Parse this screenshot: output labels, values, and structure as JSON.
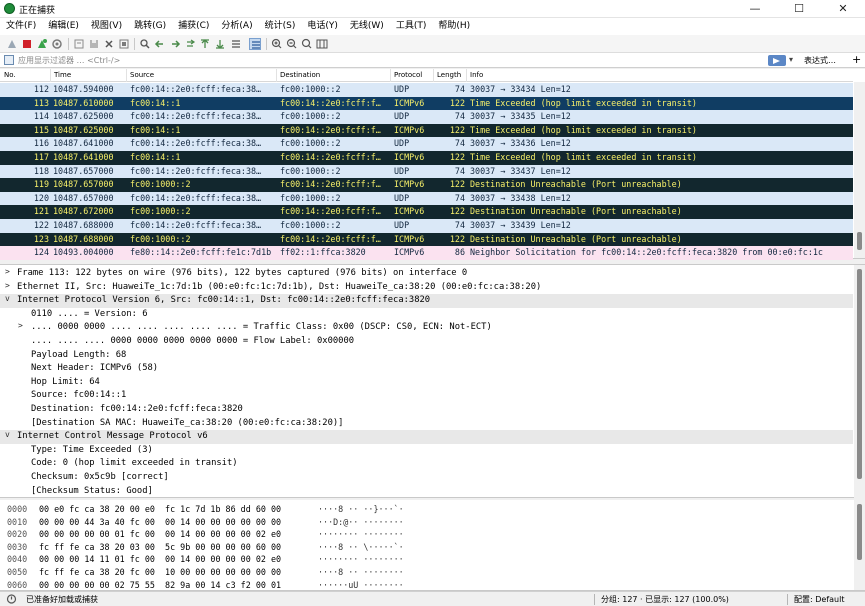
{
  "window": {
    "title": "正在捕获",
    "minimize": "—",
    "maximize": "☐",
    "close": "✕"
  },
  "menu": [
    "文件(F)",
    "编辑(E)",
    "视图(V)",
    "跳转(G)",
    "捕获(C)",
    "分析(A)",
    "统计(S)",
    "电话(Y)",
    "无线(W)",
    "工具(T)",
    "帮助(H)"
  ],
  "toolbar_icons": [
    "start-capture-icon",
    "stop-capture-icon",
    "restart-capture-icon",
    "capture-options-icon",
    "open-file-icon",
    "save-file-icon",
    "close-file-icon",
    "reload-file-icon",
    "find-packet-icon",
    "go-back-icon",
    "go-forward-icon",
    "go-to-packet-icon",
    "go-first-icon",
    "go-last-icon",
    "auto-scroll-icon",
    "colorize-icon",
    "zoom-in-icon",
    "zoom-out-icon",
    "zoom-normal-icon",
    "resize-columns-icon"
  ],
  "filter": {
    "placeholder": "应用显示过滤器 … <Ctrl-/>",
    "dropdown": "▾",
    "expression_label": "表达式…",
    "add_label": "+"
  },
  "columns": [
    "No.",
    "Time",
    "Source",
    "Destination",
    "Protocol",
    "Length",
    "Info"
  ],
  "packets": [
    {
      "no": "112",
      "time": "10487.594000",
      "src": "fc00:14::2e0:fcff:feca:38…",
      "dst": "fc00:1000::2",
      "proto": "UDP",
      "len": "74",
      "info": "30037 → 33434 Len=12",
      "style": "light"
    },
    {
      "no": "113",
      "time": "10487.610000",
      "src": "fc00:14::1",
      "dst": "fc00:14::2e0:fcff:f…",
      "proto": "ICMPv6",
      "len": "122",
      "info": "Time Exceeded (hop limit exceeded in transit)",
      "style": "selected"
    },
    {
      "no": "114",
      "time": "10487.625000",
      "src": "fc00:14::2e0:fcff:feca:38…",
      "dst": "fc00:1000::2",
      "proto": "UDP",
      "len": "74",
      "info": "30037 → 33435 Len=12",
      "style": "light"
    },
    {
      "no": "115",
      "time": "10487.625000",
      "src": "fc00:14::1",
      "dst": "fc00:14::2e0:fcff:f…",
      "proto": "ICMPv6",
      "len": "122",
      "info": "Time Exceeded (hop limit exceeded in transit)",
      "style": "dark"
    },
    {
      "no": "116",
      "time": "10487.641000",
      "src": "fc00:14::2e0:fcff:feca:38…",
      "dst": "fc00:1000::2",
      "proto": "UDP",
      "len": "74",
      "info": "30037 → 33436 Len=12",
      "style": "light"
    },
    {
      "no": "117",
      "time": "10487.641000",
      "src": "fc00:14::1",
      "dst": "fc00:14::2e0:fcff:f…",
      "proto": "ICMPv6",
      "len": "122",
      "info": "Time Exceeded (hop limit exceeded in transit)",
      "style": "dark"
    },
    {
      "no": "118",
      "time": "10487.657000",
      "src": "fc00:14::2e0:fcff:feca:38…",
      "dst": "fc00:1000::2",
      "proto": "UDP",
      "len": "74",
      "info": "30037 → 33437 Len=12",
      "style": "light"
    },
    {
      "no": "119",
      "time": "10487.657000",
      "src": "fc00:1000::2",
      "dst": "fc00:14::2e0:fcff:f…",
      "proto": "ICMPv6",
      "len": "122",
      "info": "Destination Unreachable (Port unreachable)",
      "style": "dark"
    },
    {
      "no": "120",
      "time": "10487.657000",
      "src": "fc00:14::2e0:fcff:feca:38…",
      "dst": "fc00:1000::2",
      "proto": "UDP",
      "len": "74",
      "info": "30037 → 33438 Len=12",
      "style": "light"
    },
    {
      "no": "121",
      "time": "10487.672000",
      "src": "fc00:1000::2",
      "dst": "fc00:14::2e0:fcff:f…",
      "proto": "ICMPv6",
      "len": "122",
      "info": "Destination Unreachable (Port unreachable)",
      "style": "dark"
    },
    {
      "no": "122",
      "time": "10487.688000",
      "src": "fc00:14::2e0:fcff:feca:38…",
      "dst": "fc00:1000::2",
      "proto": "UDP",
      "len": "74",
      "info": "30037 → 33439 Len=12",
      "style": "light"
    },
    {
      "no": "123",
      "time": "10487.688000",
      "src": "fc00:1000::2",
      "dst": "fc00:14::2e0:fcff:f…",
      "proto": "ICMPv6",
      "len": "122",
      "info": "Destination Unreachable (Port unreachable)",
      "style": "dark"
    },
    {
      "no": "124",
      "time": "10493.004000",
      "src": "fe80::14::2e0:fcff:fe1c:7d1b",
      "dst": "ff02::1:ffca:3820",
      "proto": "ICMPv6",
      "len": "86",
      "info": "Neighbor Solicitation for fc00:14::2e0:fcff:feca:3820 from 00:e0:fc:1c",
      "style": "pink"
    }
  ],
  "details": [
    {
      "arrow": ">",
      "text": "Frame 113: 122 bytes on wire (976 bits), 122 bytes captured (976 bits) on interface 0",
      "level": 0,
      "header": false
    },
    {
      "arrow": ">",
      "text": "Ethernet II, Src: HuaweiTe_1c:7d:1b (00:e0:fc:1c:7d:1b), Dst: HuaweiTe_ca:38:20 (00:e0:fc:ca:38:20)",
      "level": 0,
      "header": false
    },
    {
      "arrow": "v",
      "text": "Internet Protocol Version 6, Src: fc00:14::1, Dst: fc00:14::2e0:fcff:feca:3820",
      "level": 0,
      "header": true
    },
    {
      "arrow": "",
      "text": "0110 .... = Version: 6",
      "level": 1,
      "header": false
    },
    {
      "arrow": ">",
      "text": ".... 0000 0000 .... .... .... .... .... = Traffic Class: 0x00 (DSCP: CS0, ECN: Not-ECT)",
      "level": 1,
      "header": false
    },
    {
      "arrow": "",
      "text": ".... .... .... 0000 0000 0000 0000 0000 = Flow Label: 0x00000",
      "level": 1,
      "header": false
    },
    {
      "arrow": "",
      "text": "Payload Length: 68",
      "level": 1,
      "header": false
    },
    {
      "arrow": "",
      "text": "Next Header: ICMPv6 (58)",
      "level": 1,
      "header": false
    },
    {
      "arrow": "",
      "text": "Hop Limit: 64",
      "level": 1,
      "header": false
    },
    {
      "arrow": "",
      "text": "Source: fc00:14::1",
      "level": 1,
      "header": false
    },
    {
      "arrow": "",
      "text": "Destination: fc00:14::2e0:fcff:feca:3820",
      "level": 1,
      "header": false
    },
    {
      "arrow": "",
      "text": "[Destination SA MAC: HuaweiTe_ca:38:20 (00:e0:fc:ca:38:20)]",
      "level": 1,
      "header": false
    },
    {
      "arrow": "v",
      "text": "Internet Control Message Protocol v6",
      "level": 0,
      "header": true
    },
    {
      "arrow": "",
      "text": "Type: Time Exceeded (3)",
      "level": 1,
      "header": false
    },
    {
      "arrow": "",
      "text": "Code: 0 (hop limit exceeded in transit)",
      "level": 1,
      "header": false
    },
    {
      "arrow": "",
      "text": "Checksum: 0x5c9b [correct]",
      "level": 1,
      "header": false
    },
    {
      "arrow": "",
      "text": "[Checksum Status: Good]",
      "level": 1,
      "header": false
    }
  ],
  "hex_rows": [
    {
      "offset": "0000",
      "bytes": "00 e0 fc ca 38 20 00 e0  fc 1c 7d 1b 86 dd 60 00",
      "ascii": "····8 ·· ··}···`·"
    },
    {
      "offset": "0010",
      "bytes": "00 00 00 44 3a 40 fc 00  00 14 00 00 00 00 00 00",
      "ascii": "···D:@·· ········"
    },
    {
      "offset": "0020",
      "bytes": "00 00 00 00 00 01 fc 00  00 14 00 00 00 00 02 e0",
      "ascii": "········ ········"
    },
    {
      "offset": "0030",
      "bytes": "fc ff fe ca 38 20 03 00  5c 9b 00 00 00 00 60 00",
      "ascii": "····8 ·· \\·····`·"
    },
    {
      "offset": "0040",
      "bytes": "00 00 00 14 11 01 fc 00  00 14 00 00 00 00 02 e0",
      "ascii": "········ ········"
    },
    {
      "offset": "0050",
      "bytes": "fc ff fe ca 38 20 fc 00  10 00 00 00 00 00 00 00",
      "ascii": "····8 ·· ········"
    },
    {
      "offset": "0060",
      "bytes": "00 00 00 00 00 02 75 55  82 9a 00 14 c3 f2 00 01",
      "ascii": "······uU ········"
    }
  ],
  "status": {
    "left": "已准备好加载或捕获",
    "packets": "分组: 127 · 已显示: 127 (100.0%)",
    "profile": "配置: Default"
  },
  "colors": {
    "row_light": "#dae8f7",
    "row_dark": "#12272e",
    "row_selected": "#103d63",
    "row_pink": "#fbe2f0",
    "dark_text": "#f7f06a"
  }
}
